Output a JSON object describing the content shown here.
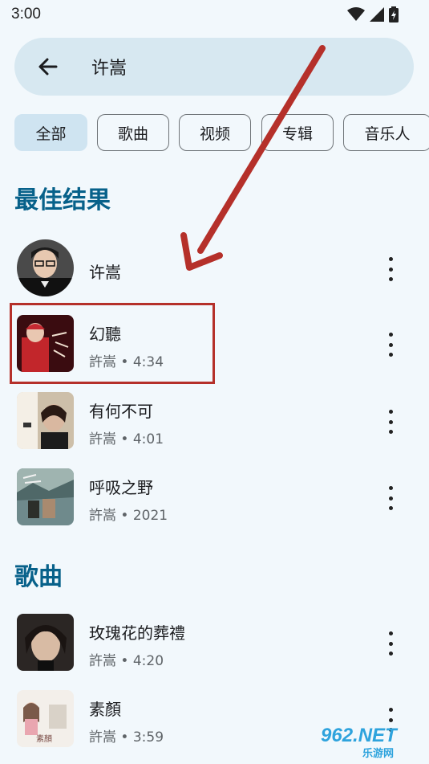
{
  "status_bar": {
    "time": "3:00"
  },
  "search": {
    "query": "许嵩"
  },
  "filters": [
    {
      "label": "全部",
      "selected": true
    },
    {
      "label": "歌曲",
      "selected": false
    },
    {
      "label": "视频",
      "selected": false
    },
    {
      "label": "专辑",
      "selected": false
    },
    {
      "label": "音乐人",
      "selected": false
    }
  ],
  "best_results": {
    "title": "最佳结果",
    "items": [
      {
        "title": "许嵩",
        "subtitle": ""
      },
      {
        "title": "幻聽",
        "subtitle": "許嵩 • 4:34"
      },
      {
        "title": "有何不可",
        "subtitle": "許嵩 • 4:01"
      },
      {
        "title": "呼吸之野",
        "subtitle": "許嵩 • 2021"
      }
    ]
  },
  "songs": {
    "title": "歌曲",
    "items": [
      {
        "title": "玫瑰花的葬禮",
        "subtitle": "許嵩 • 4:20"
      },
      {
        "title": "素顏",
        "subtitle": "許嵩 • 3:59"
      }
    ]
  },
  "watermark": {
    "line1": "962.NET",
    "line2": "乐游网"
  },
  "colors": {
    "accent": "#07618a",
    "annotation": "#b5302a"
  }
}
